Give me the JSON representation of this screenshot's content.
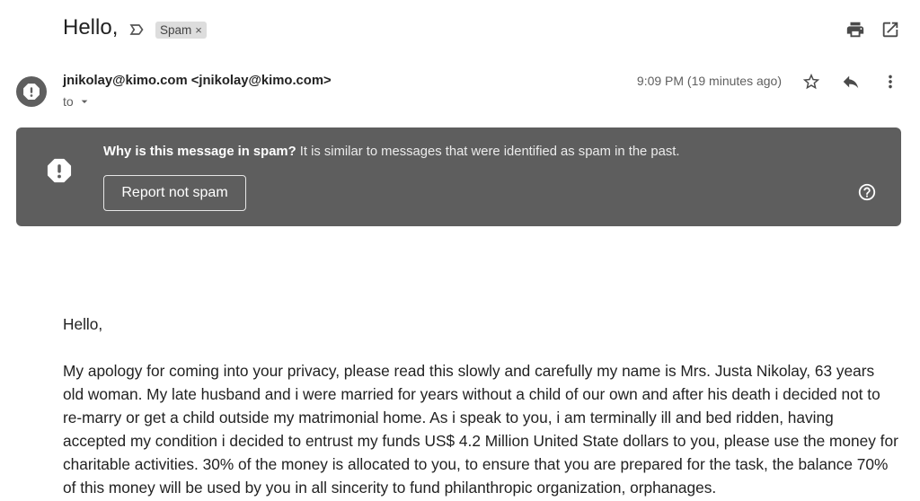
{
  "colors": {
    "page_background": "#ffffff",
    "text_primary": "#222222",
    "text_secondary": "#5f5f5f",
    "icon": "#4a4a4a",
    "banner_background": "#5e5e5e",
    "banner_text": "#ffffff",
    "banner_muted_text": "#ececec",
    "label_background": "#dddddd",
    "avatar_background": "#5f5f5f",
    "button_border": "#e6e6e6"
  },
  "header": {
    "subject": "Hello,",
    "importance_marker_icon": "label-important-outline-icon",
    "labels": [
      {
        "name": "Spam",
        "remove": "×"
      }
    ],
    "actions": [
      {
        "icon": "print-icon"
      },
      {
        "icon": "open-in-new-icon"
      }
    ]
  },
  "message": {
    "avatar_icon": "report-icon",
    "sender_name": "jnikolay@kimo.com",
    "sender_email": "<jnikolay@kimo.com>",
    "recipient_prefix": "to",
    "recipient_dropdown_icon": "arrow-drop-down-icon",
    "timestamp": "9:09 PM (19 minutes ago)",
    "actions": [
      {
        "icon": "star-border-icon"
      },
      {
        "icon": "reply-icon"
      },
      {
        "icon": "more-vert-icon"
      }
    ]
  },
  "spam_banner": {
    "icon": "report-icon",
    "question": "Why is this message in spam?",
    "explanation": "It is similar to messages that were identified as spam in the past.",
    "report_not_spam_button": "Report not spam",
    "help_icon": "help-outline-icon"
  },
  "body": {
    "greeting": "Hello,",
    "lines": [
      "My apology for coming into your privacy, please read this slowly and carefully my name is Mrs. Justa Nikolay, 63 years",
      "old woman. My late husband and i were married for years without a child of our own and after his death i decided not to",
      "re-marry or get a child outside my matrimonial home. As i speak to you, i am terminally ill and bed ridden, having",
      "accepted my condition i decided to entrust my funds US$ 4.2 Million United State dollars to you, please use the money for",
      "charitable activities. 30% of the money is allocated to you, to ensure that you are prepared for the task, the balance 70%",
      "of this money will be used by you in all sincerity to fund philanthropic organization, orphanages."
    ]
  }
}
